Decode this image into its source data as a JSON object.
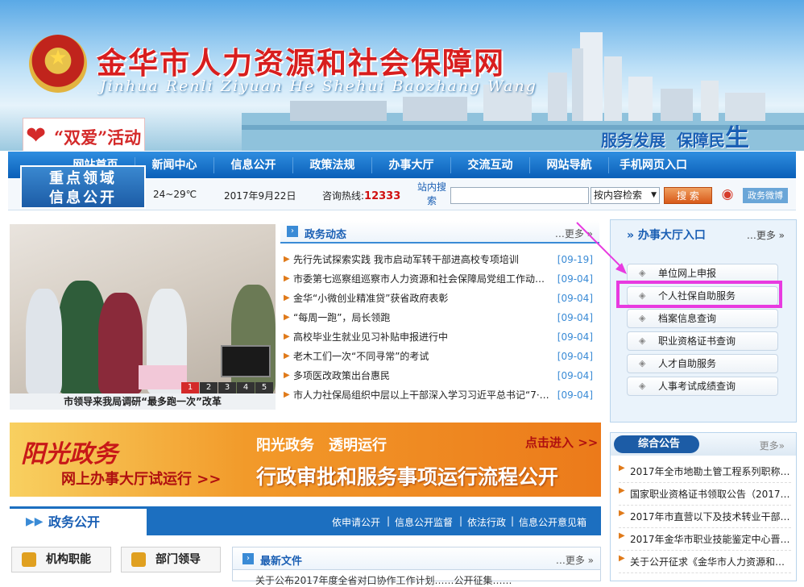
{
  "header": {
    "title": "金华市人力资源和社会保障网",
    "pinyin": "Jinhua Renli Ziyuan He Shehui Baozhang Wang",
    "slogan_a": "服务发展",
    "slogan_b": "保障民",
    "slogan_c": "生",
    "shuangai": "“双爱”活动"
  },
  "nav": [
    "网站首页",
    "新闻中心",
    "信息公开",
    "政策法规",
    "办事大厅",
    "交流互动",
    "网站导航",
    "手机网页入口"
  ],
  "zhongdian": {
    "line1": "重点领域",
    "line2": "信息公开"
  },
  "infobar": {
    "weather": "24~29℃",
    "date": "2017年9月22日",
    "hotline_label": "咨询热线:",
    "hotline": "12333",
    "search_label": "站内搜索",
    "search_placeholder": "",
    "search_option": "按内容检索",
    "search_button": "搜 索",
    "weibo": "政务微博"
  },
  "photo": {
    "caption": "市领导来我局调研“最多跑一次”改革",
    "pages": [
      "1",
      "2",
      "3",
      "4",
      "5"
    ]
  },
  "news": {
    "title": "政务动态",
    "more": "更多",
    "items": [
      {
        "t": "先行先试探索实践 我市启动军转干部进高校专项培训",
        "d": "[09-19]"
      },
      {
        "t": "市委第七巡察组巡察市人力资源和社会保障局党组工作动员会",
        "d": "[09-04]"
      },
      {
        "t": "金华“小微创业精准贷”获省政府表彰",
        "d": "[09-04]"
      },
      {
        "t": "“每周一跑”，局长领跑",
        "d": "[09-04]"
      },
      {
        "t": "高校毕业生就业见习补贴申报进行中",
        "d": "[09-04]"
      },
      {
        "t": "老木工们一次“不同寻常”的考试",
        "d": "[09-04]"
      },
      {
        "t": "多项医改政策出台惠民",
        "d": "[09-04]"
      },
      {
        "t": "市人力社保局组织中层以上干部深入学习习近平总书记“7·26”重要讲话",
        "d": "[09-04]"
      }
    ]
  },
  "service": {
    "title": "办事大厅入口",
    "more": "更多",
    "items": [
      "单位网上申报",
      "个人社保自助服务",
      "档案信息查询",
      "职业资格证书查询",
      "人才自助服务",
      "人事考试成绩查询"
    ]
  },
  "banner": {
    "b1": "阳光政务",
    "b2": "网上办事大厅试运行 >>",
    "b3": "阳光政务　透明运行",
    "b4": "点击进入 >>",
    "b5": "行政审批和服务事项运行流程公开"
  },
  "gonggao": {
    "title": "综合公告",
    "more": "更多",
    "items": [
      "2017年全市地勘土管工程系列职称评审结果公示",
      "国家职业资格证书领取公告（2017年第三批）",
      "2017年市直营以下及技术转业干部考核结果公示",
      "2017年金华市职业技能鉴定中心晋级考试安排",
      "关于公开征求《金华市人力资源和社会保障局……》意见"
    ]
  },
  "zhengwu": {
    "title": "政务公开",
    "links": [
      "依申请公开",
      "信息公开监督",
      "依法行政",
      "信息公开意见箱"
    ],
    "sep": "|"
  },
  "boxes": {
    "jigou": "机构职能",
    "lingdao": "部门领导"
  },
  "wenjian": {
    "title": "最新文件",
    "more": "更多",
    "row": "关于公布2017年度全省对口协作工作计划……公开征集……"
  },
  "colors": {
    "brand": "#1a5fb4",
    "accent": "#d81e1e",
    "highlight": "#e83ae0"
  }
}
